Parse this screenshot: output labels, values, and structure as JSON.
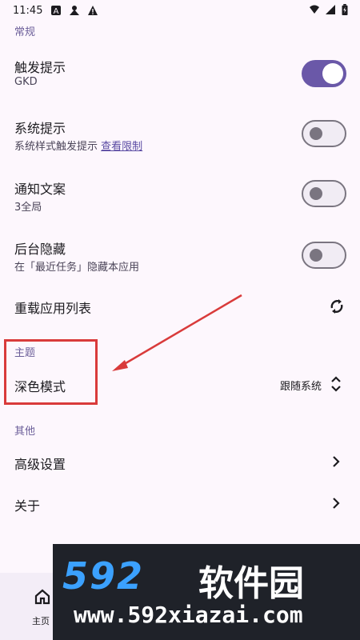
{
  "status_bar": {
    "time": "11:45",
    "icons_left": [
      "a-icon",
      "user-icon",
      "warning-icon"
    ],
    "icons_right": [
      "wifi-icon",
      "signal-icon",
      "battery-icon"
    ]
  },
  "sections": {
    "general": "常规",
    "theme": "主题",
    "other": "其他"
  },
  "settings": {
    "trigger_toast": {
      "title": "触发提示",
      "subtitle": "GKD",
      "enabled": true
    },
    "system_toast": {
      "title": "系统提示",
      "subtitle": "系统样式触发提示",
      "link": "查看限制",
      "enabled": false
    },
    "notification_text": {
      "title": "通知文案",
      "subtitle": "3全局",
      "enabled": false
    },
    "hide_in_recents": {
      "title": "后台隐藏",
      "subtitle": "在「最近任务」隐藏本应用",
      "enabled": false
    },
    "reload_app_list": {
      "title": "重载应用列表",
      "icon": "refresh-icon"
    },
    "dark_mode": {
      "title": "深色模式",
      "value": "跟随系统",
      "icon": "unfold-icon"
    },
    "advanced": {
      "title": "高级设置",
      "icon": "chevron-right-icon"
    },
    "about": {
      "title": "关于",
      "icon": "chevron-right-icon"
    }
  },
  "bottom_nav": {
    "home_label": "主页",
    "home_icon": "home-icon"
  },
  "watermark": {
    "logo": "592",
    "brand": "软件园",
    "url": "www.592xiazai.com"
  },
  "colors": {
    "accent": "#6a58a8",
    "section_header": "#6b5e99",
    "highlight": "#d93b3b"
  }
}
